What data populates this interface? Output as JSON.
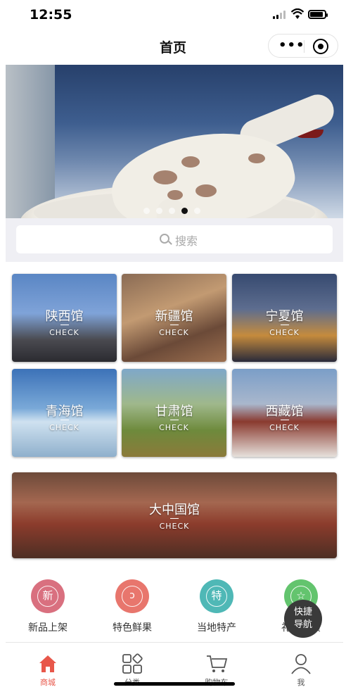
{
  "status_bar": {
    "time": "12:55"
  },
  "nav": {
    "title": "首页",
    "more_icon": "more-dots-icon",
    "close_icon": "target-close-icon"
  },
  "banner": {
    "slide_count": 5,
    "active_index": 3
  },
  "search": {
    "placeholder": "搜索"
  },
  "pavilions": [
    {
      "name": "陕西馆",
      "sub": "CHECK"
    },
    {
      "name": "新疆馆",
      "sub": "CHECK"
    },
    {
      "name": "宁夏馆",
      "sub": "CHECK"
    },
    {
      "name": "青海馆",
      "sub": "CHECK"
    },
    {
      "name": "甘肃馆",
      "sub": "CHECK"
    },
    {
      "name": "西藏馆",
      "sub": "CHECK"
    }
  ],
  "feature_pavilion": {
    "name": "大中国馆",
    "sub": "CHECK"
  },
  "categories": [
    {
      "label": "新品上架",
      "glyph": "新",
      "color": "#d9707f"
    },
    {
      "label": "特色鲜果",
      "glyph": "🍎",
      "color": "#e8766d"
    },
    {
      "label": "当地特产",
      "glyph": "特",
      "color": "#4fb8b6"
    },
    {
      "label": "礼品特质",
      "glyph": "☆",
      "color": "#63c46e"
    }
  ],
  "fab": {
    "line1": "快捷",
    "line2": "导航"
  },
  "tabs": [
    {
      "label": "商城",
      "icon": "home-icon",
      "active": true
    },
    {
      "label": "分类",
      "icon": "category-icon",
      "active": false
    },
    {
      "label": "购物车",
      "icon": "cart-icon",
      "active": false
    },
    {
      "label": "我",
      "icon": "user-icon",
      "active": false
    }
  ],
  "colors": {
    "accent": "#e8574a"
  }
}
